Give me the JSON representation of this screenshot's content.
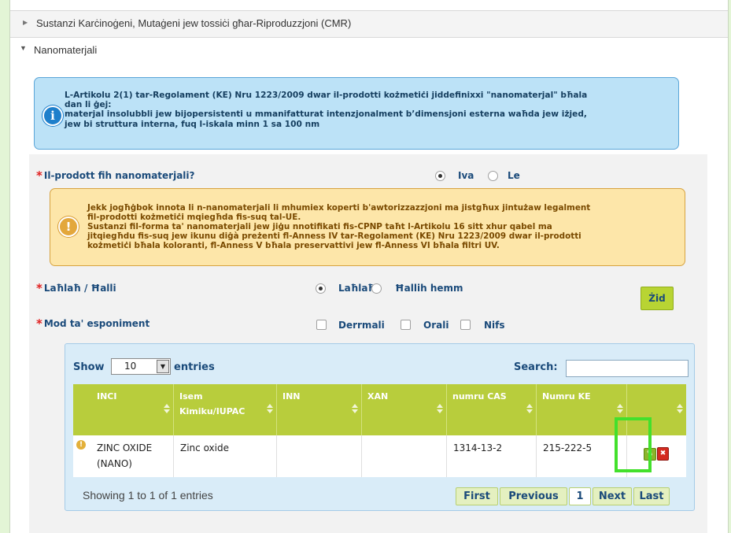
{
  "sections": {
    "cmr_title": "Sustanzi Karċinoġeni, Mutaġeni jew tossiċi għar-Riproduzzjoni (CMR)",
    "nano_title": "Nanomaterjali"
  },
  "info_box": {
    "line1": "L-Artikolu 2(1) tar-Regolament (KE) Nru 1223/2009 dwar il-prodotti kożmetiċi jiddefinixxi \"nanomaterjal\" bħala",
    "line2": "dan li ġej:",
    "line3": "materjal insolubbli jew bijopersistenti u mmanifatturat intenzjonalment b’dimensjoni esterna waħda jew iżjed,",
    "line4": "jew bi struttura interna, fuq l-iskala minn 1 sa 100 nm"
  },
  "question": {
    "required_mark": "*",
    "label": "Il-prodott fih nanomaterjali?",
    "opt_yes": "Iva",
    "opt_no": "Le",
    "selected": "Iva"
  },
  "warning_box": {
    "line1": "Jekk jogħġbok innota li n-nanomaterjali li mhumiex koperti b'awtorizzazzjoni ma jistgħux jintużaw legalment",
    "line2": "fil-prodotti kożmetiċi mqiegħda fis-suq tal-UE.",
    "line3": "Sustanzi fil-forma ta' nanomaterjali jew jiġu nnotifikati fis-CPNP taħt l-Artikolu 16 sitt xhur qabel ma",
    "line4": "jitqiegħdu fis-suq jew ikunu diġà preżenti fl-Anness IV tar-Regolament (KE) Nru 1223/2009 dwar il-prodotti",
    "line5": "kożmetiċi bħala koloranti, fl-Anness V bħala preservattivi jew fl-Anness VI bħala filtri UV."
  },
  "lahlah": {
    "required_mark": "*",
    "label": "Laħlaħ / Ħalli",
    "opt_lahlah": "Laħlaħ",
    "opt_hallih": "Ħallih hemm",
    "selected": "Laħlaħ"
  },
  "add_button": "Żid",
  "exposure": {
    "required_mark": "*",
    "label": "Mod ta' esponiment",
    "opt_dermal": "Derrmali",
    "opt_oral": "Orali",
    "opt_nifs": "Nifs"
  },
  "table": {
    "show_label": "Show",
    "page_size": "10",
    "entries_label": "entries",
    "search_label": "Search:",
    "search_value": "",
    "columns": [
      "INCI",
      "Isem Kimiku/IUPAC",
      "INN",
      "XAN",
      "numru CAS",
      "Numru KE"
    ],
    "rows": [
      {
        "inci": "ZINC OXIDE (NANO)",
        "chemical_name": "Zinc oxide",
        "inn": "",
        "xan": "",
        "cas": "1314-13-2",
        "ec": "215-222-5"
      }
    ],
    "footer": "Showing 1 to 1 of 1 entries",
    "pager": {
      "first": "First",
      "previous": "Previous",
      "page": "1",
      "next": "Next",
      "last": "Last"
    }
  },
  "colors": {
    "accent_green": "#b8cd3c",
    "info_blue": "#bce2f7",
    "warning_yellow": "#fde6a9",
    "highlight": "#43e02c",
    "required_red": "#e02020"
  },
  "icons": {
    "section_collapsed": "triangle-right-icon",
    "section_expanded": "triangle-down-icon",
    "info": "info-circle-icon",
    "warning": "exclamation-circle-icon",
    "row_warning": "warning-dot-icon",
    "edit": "pencil-icon",
    "delete": "trash-icon"
  }
}
